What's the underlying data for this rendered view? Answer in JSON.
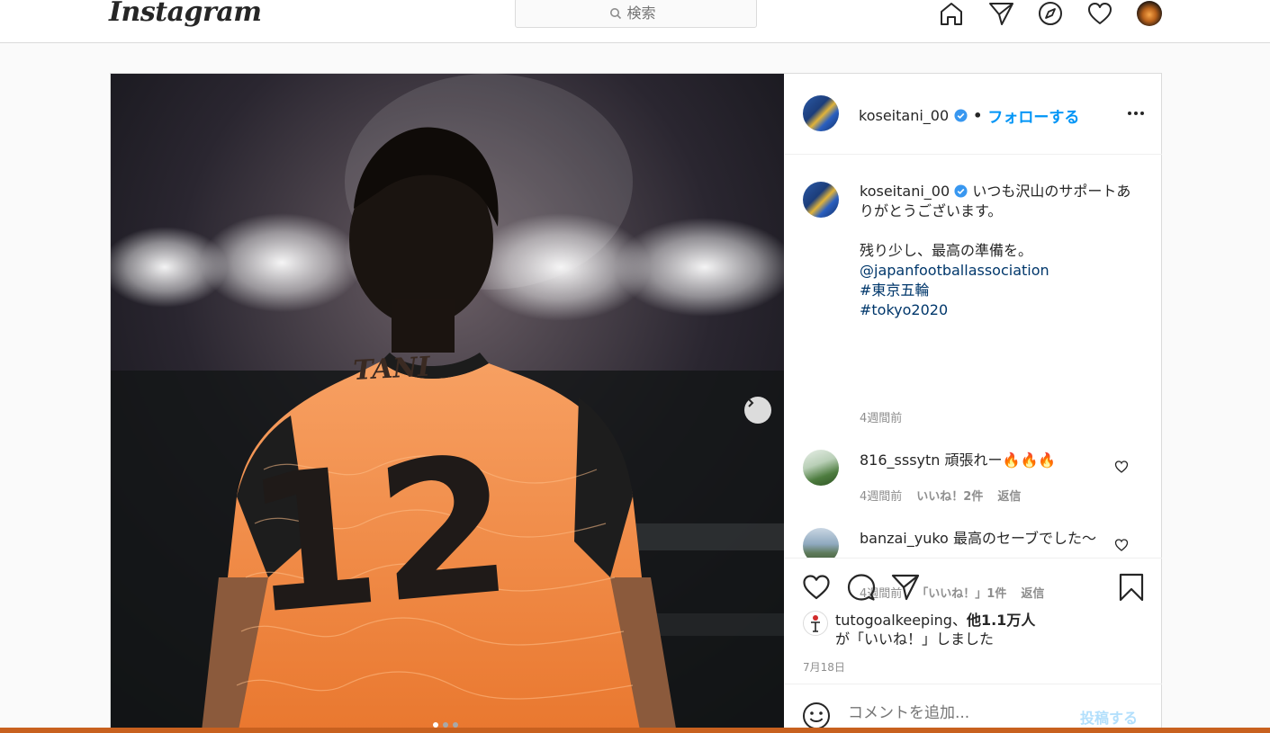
{
  "topnav": {
    "logo_text": "Instagram",
    "search_placeholder": "検索",
    "icons": [
      "home-icon",
      "direct-icon",
      "explore-icon",
      "activity-heart-icon",
      "profile-avatar"
    ]
  },
  "post": {
    "author": "koseitani_00",
    "follow_label": "フォローする",
    "separator": "•",
    "caption_lines": [
      "いつも沢山のサポートありがとうございます。",
      "残り少し、最高の準備を。"
    ],
    "caption_links": [
      "@japanfootballassociation",
      "#東京五輪",
      "#tokyo2020"
    ],
    "caption_time": "4週間前",
    "jersey_name": "TANI",
    "jersey_number": "12",
    "comments": [
      {
        "user": "816_sssytn",
        "text": "頑張れー🔥🔥🔥",
        "time": "4週間前",
        "likes": "いいね！2件",
        "reply": "返信"
      },
      {
        "user": "banzai_yuko",
        "text": "最高のセーブでした〜",
        "time": "4週間前",
        "likes": "「いいね！」1件",
        "reply": "返信"
      }
    ],
    "liked_by_user": "tutogoalkeeping",
    "liked_by_others": "他1.1万人",
    "liked_by_sep": "、",
    "liked_suffix": "が「いいね！」しました",
    "date": "7月18日",
    "add_comment_placeholder": "コメントを追加...",
    "post_button": "投稿する",
    "carousel_count": 3,
    "carousel_active": 1
  },
  "colors": {
    "accent": "#0095f6",
    "link": "#00376b",
    "jersey": "#f28a3c",
    "muted": "#8e8e8e"
  }
}
